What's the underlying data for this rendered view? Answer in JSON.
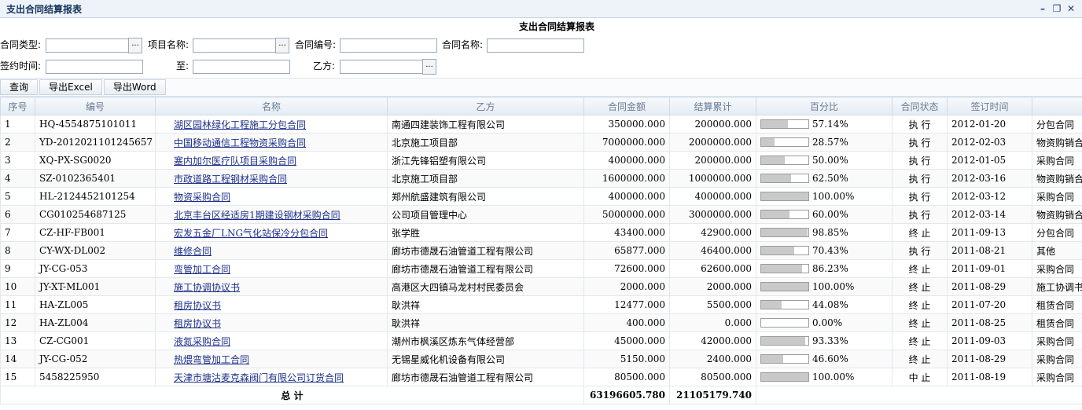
{
  "window": {
    "title": "支出合同结算报表",
    "minimize_icon": "minimize-icon",
    "restore_icon": "restore-icon",
    "close_icon": "close-icon"
  },
  "report_title": "支出合同结算报表",
  "filters": {
    "contract_type_label": "合同类型:",
    "project_name_label": "项目名称:",
    "contract_no_label": "合同编号:",
    "contract_name_label": "合同名称:",
    "sign_time_label": "签约时间:",
    "to_label": "至:",
    "party_b_label": "乙方:",
    "picker_label": "..."
  },
  "toolbar": {
    "query": "查询",
    "export_excel": "导出Excel",
    "export_word": "导出Word"
  },
  "columns": [
    "序号",
    "编号",
    "名称",
    "乙方",
    "合同金额",
    "结算累计",
    "百分比",
    "合同状态",
    "签订时间",
    ""
  ],
  "rows": [
    {
      "idx": "1",
      "code": "HQ-4554875101011",
      "name": "湖区园林绿化工程施工分包合同",
      "party": "南通四建装饰工程有限公司",
      "amount": "350000.000",
      "settled": "200000.000",
      "pct": 0.5714,
      "pct_text": "57.14%",
      "status": "执 行",
      "date": "2012-01-20",
      "type": "分包合同"
    },
    {
      "idx": "2",
      "code": "YD-2012021101245657",
      "name": "中国移动通信工程物资采购合同",
      "party": "北京施工项目部",
      "amount": "7000000.000",
      "settled": "2000000.000",
      "pct": 0.2857,
      "pct_text": "28.57%",
      "status": "执 行",
      "date": "2012-02-03",
      "type": "物资购销合"
    },
    {
      "idx": "3",
      "code": "XQ-PX-SG0020",
      "name": "塞内加尔医疗队项目采购合同",
      "party": "浙江先锋铝塑有限公司",
      "amount": "400000.000",
      "settled": "200000.000",
      "pct": 0.5,
      "pct_text": "50.00%",
      "status": "执 行",
      "date": "2012-01-05",
      "type": "采购合同"
    },
    {
      "idx": "4",
      "code": "SZ-0102365401",
      "name": "市政道路工程钢材采购合同",
      "party": "北京施工项目部",
      "amount": "1600000.000",
      "settled": "1000000.000",
      "pct": 0.625,
      "pct_text": "62.50%",
      "status": "执 行",
      "date": "2012-03-16",
      "type": "物资购销合"
    },
    {
      "idx": "5",
      "code": "HL-2124452101254",
      "name": "物资采购合同",
      "party": "郑州航盛建筑有限公司",
      "amount": "400000.000",
      "settled": "400000.000",
      "pct": 1.0,
      "pct_text": "100.00%",
      "status": "执 行",
      "date": "2012-03-12",
      "type": "采购合同"
    },
    {
      "idx": "6",
      "code": "CG010254687125",
      "name": "北京丰台区经适房1期建设钢材采购合同",
      "party": "公司项目管理中心",
      "amount": "5000000.000",
      "settled": "3000000.000",
      "pct": 0.6,
      "pct_text": "60.00%",
      "status": "执 行",
      "date": "2012-03-14",
      "type": "物资购销合"
    },
    {
      "idx": "7",
      "code": "CZ-HF-FB001",
      "name": "宏发五金厂LNG气化站保冷分包合同",
      "party": "张学胜",
      "amount": "43400.000",
      "settled": "42900.000",
      "pct": 0.9885,
      "pct_text": "98.85%",
      "status": "终 止",
      "date": "2011-09-13",
      "type": "分包合同"
    },
    {
      "idx": "8",
      "code": "CY-WX-DL002",
      "name": "维修合同",
      "party": "廊坊市德晟石油管道工程有限公司",
      "amount": "65877.000",
      "settled": "46400.000",
      "pct": 0.7043,
      "pct_text": "70.43%",
      "status": "执 行",
      "date": "2011-08-21",
      "type": "其他"
    },
    {
      "idx": "9",
      "code": "JY-CG-053",
      "name": "弯管加工合同",
      "party": "廊坊市德晟石油管道工程有限公司",
      "amount": "72600.000",
      "settled": "62600.000",
      "pct": 0.8623,
      "pct_text": "86.23%",
      "status": "终 止",
      "date": "2011-09-01",
      "type": "采购合同"
    },
    {
      "idx": "10",
      "code": "JY-XT-ML001",
      "name": "施工协调协议书",
      "party": "高港区大四镇马龙村村民委员会",
      "amount": "2000.000",
      "settled": "2000.000",
      "pct": 1.0,
      "pct_text": "100.00%",
      "status": "终 止",
      "date": "2011-08-29",
      "type": "施工协调书"
    },
    {
      "idx": "11",
      "code": "HA-ZL005",
      "name": "租房协议书",
      "party": "耿洪祥",
      "amount": "12477.000",
      "settled": "5500.000",
      "pct": 0.4408,
      "pct_text": "44.08%",
      "status": "终 止",
      "date": "2011-07-20",
      "type": "租赁合同"
    },
    {
      "idx": "12",
      "code": "HA-ZL004",
      "name": "租房协议书",
      "party": "耿洪祥",
      "amount": "400.000",
      "settled": "0.000",
      "pct": 0.0,
      "pct_text": "0.00%",
      "status": "终 止",
      "date": "2011-08-25",
      "type": "租赁合同"
    },
    {
      "idx": "13",
      "code": "CZ-CG001",
      "name": "液氮采购合同",
      "party": "潮州市枫溪区炼东气体经营部",
      "amount": "45000.000",
      "settled": "42000.000",
      "pct": 0.9333,
      "pct_text": "93.33%",
      "status": "终 止",
      "date": "2011-09-03",
      "type": "采购合同"
    },
    {
      "idx": "14",
      "code": "JY-CG-052",
      "name": "热煨弯管加工合同",
      "party": "无锡星威化机设备有限公司",
      "amount": "5150.000",
      "settled": "2400.000",
      "pct": 0.466,
      "pct_text": "46.60%",
      "status": "终 止",
      "date": "2011-08-29",
      "type": "采购合同"
    },
    {
      "idx": "15",
      "code": "5458225950",
      "name": "天津市塘沽麦克森阀门有限公司订货合同",
      "party": "廊坊市德晟石油管道工程有限公司",
      "amount": "80500.000",
      "settled": "80500.000",
      "pct": 1.0,
      "pct_text": "100.00%",
      "status": "中 止",
      "date": "2011-08-19",
      "type": "采购合同"
    }
  ],
  "totals": {
    "label": "总 计",
    "amount": "63196605.780",
    "settled": "21105179.740"
  },
  "colors": {
    "link": "#1b2f8a",
    "header_text": "#6a7c93",
    "bar_fill": "#c9c9c9"
  }
}
